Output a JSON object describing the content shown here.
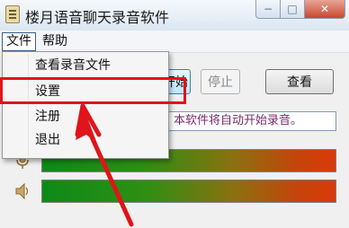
{
  "window": {
    "title": "楼月语音聊天录音软件"
  },
  "window_controls": {
    "minimize": "−",
    "maximize": "□",
    "close": "✕"
  },
  "menubar": {
    "file": "文件",
    "help": "帮助"
  },
  "file_menu": {
    "items": [
      "查看录音文件",
      "设置",
      "注册",
      "退出"
    ],
    "highlighted_item": "设置"
  },
  "toolbar": {
    "start_label_partial": "开始",
    "stop_label": "停止",
    "view_label": "查看"
  },
  "info": {
    "message_partial": "本软件将自动开始录音。"
  },
  "levels": {
    "mic_icon": "microphone-icon",
    "speaker_icon": "speaker-icon"
  },
  "annotation": {
    "box_color": "#e0141a",
    "arrow_color": "#e0141a"
  }
}
